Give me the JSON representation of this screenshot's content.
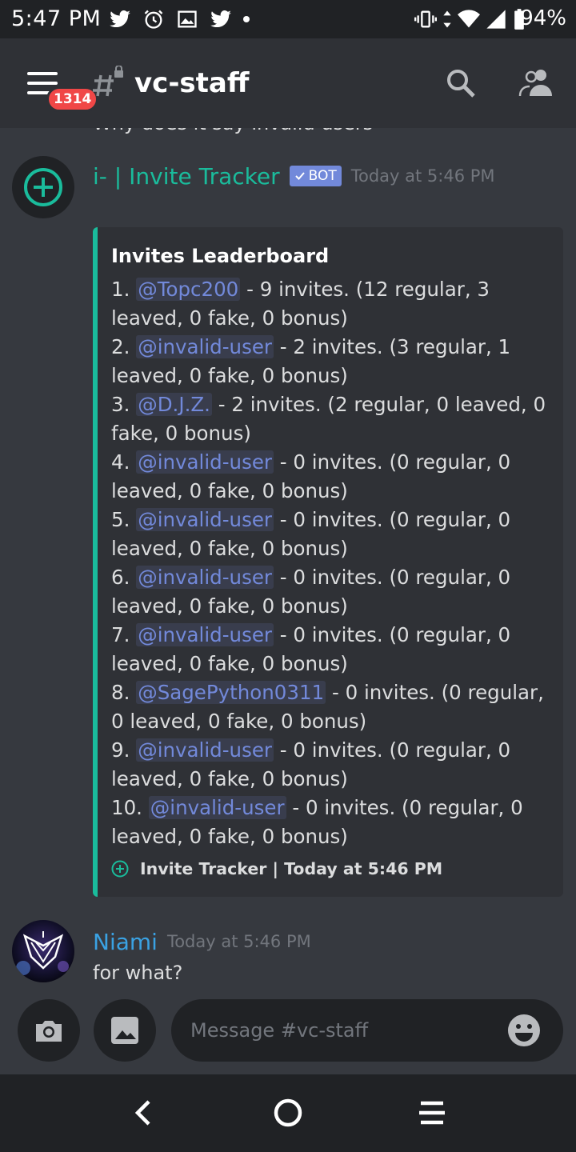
{
  "status_bar": {
    "time": "5:47 PM",
    "battery_percent": "94%",
    "icons_left": [
      "twitter-icon",
      "alarm-icon",
      "gallery-icon",
      "twitter-icon",
      "notification-dot-icon"
    ],
    "icons_right": [
      "vibrate-icon",
      "data-arrows-icon",
      "wifi-icon",
      "signal-icon",
      "battery-icon"
    ]
  },
  "header": {
    "unread_badge": "1314",
    "channel_name": "vc-staff",
    "icons": [
      "menu-icon",
      "locked-channel-icon",
      "search-icon",
      "members-icon"
    ]
  },
  "messages": {
    "previous_cut_text": "Why does it say invalid users",
    "bot_message": {
      "author": "i- | Invite Tracker",
      "tag": "BOT",
      "timestamp": "Today at 5:46 PM",
      "embed": {
        "title": "Invites Leaderboard",
        "entries": [
          {
            "rank": "1.",
            "mention": "@Topc200",
            "text": "- 9 invites. (12 regular, 3 leaved, 0 fake, 0 bonus)"
          },
          {
            "rank": "2.",
            "mention": "@invalid-user",
            "text": "- 2 invites. (3 regular, 1 leaved, 0 fake, 0 bonus)"
          },
          {
            "rank": "3.",
            "mention": "@D.J.Z.",
            "text": "- 2 invites. (2 regular, 0 leaved, 0 fake, 0 bonus)"
          },
          {
            "rank": "4.",
            "mention": "@invalid-user",
            "text": "- 0 invites. (0 regular, 0 leaved, 0 fake, 0 bonus)"
          },
          {
            "rank": "5.",
            "mention": "@invalid-user",
            "text": "- 0 invites. (0 regular, 0 leaved, 0 fake, 0 bonus)"
          },
          {
            "rank": "6.",
            "mention": "@invalid-user",
            "text": "- 0 invites. (0 regular, 0 leaved, 0 fake, 0 bonus)"
          },
          {
            "rank": "7.",
            "mention": "@invalid-user",
            "text": "- 0 invites. (0 regular, 0 leaved, 0 fake, 0 bonus)"
          },
          {
            "rank": "8.",
            "mention": "@SagePython0311",
            "text": "- 0 invites. (0 regular, 0 leaved, 0 fake, 0 bonus)"
          },
          {
            "rank": "9.",
            "mention": "@invalid-user",
            "text": "- 0 invites. (0 regular, 0 leaved, 0 fake, 0 bonus)"
          },
          {
            "rank": "10.",
            "mention": "@invalid-user",
            "text": "- 0 invites. (0 regular, 0 leaved, 0 fake, 0 bonus)"
          }
        ],
        "footer": "Invite Tracker | Today at 5:46 PM"
      }
    },
    "user_message": {
      "author": "Niami",
      "timestamp": "Today at 5:46 PM",
      "text": "for what?"
    }
  },
  "input_bar": {
    "placeholder": "Message #vc-staff",
    "icons": [
      "camera-icon",
      "image-icon",
      "emoji-icon"
    ]
  },
  "nav_bar": {
    "icons": [
      "back-icon",
      "home-icon",
      "recents-icon"
    ]
  },
  "colors": {
    "background": "#36393f",
    "header": "#2f3136",
    "bars": "#202225",
    "bot_name": "#1abc9c",
    "user_name": "#3aa2e3",
    "mention": "#7289da",
    "badge": "#f04747"
  }
}
